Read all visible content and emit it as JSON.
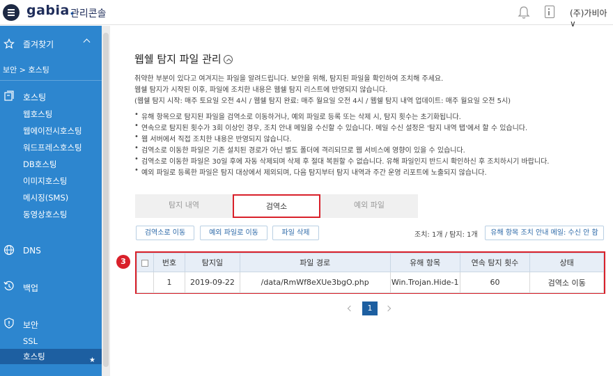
{
  "header": {
    "logo": "gabia",
    "logo_dot": ".",
    "title": "관리콘솔",
    "user": "(주)가비아 ∨"
  },
  "sidebar": {
    "favorites_label": "즐겨찾기",
    "favorite_item": "보안 > 호스팅",
    "groups": [
      {
        "title": "호스팅",
        "items": [
          "웹호스팅",
          "웹에이전시호스팅",
          "워드프레스호스팅",
          "DB호스팅",
          "이미지호스팅",
          "메시징(SMS)",
          "동영상호스팅"
        ]
      },
      {
        "title": "DNS",
        "items": []
      },
      {
        "title": "백업",
        "items": []
      },
      {
        "title": "보안",
        "items": [
          "SSL",
          "호스팅"
        ]
      }
    ],
    "active_star": "★"
  },
  "main": {
    "title": "웹쉘 탐지 파일 관리",
    "intro": [
      "취약한 부분이 있다고 여겨지는 파일을 알려드립니다. 보안을 위해, 탐지된 파일을 확인하여 조치해 주세요.",
      "웹쉘 탐지가 시작된 이후, 파일에 조치한 내용은 웹쉘 탐지 리스트에 반영되지 않습니다.",
      "(웹쉘 탐지 시작: 매주 토요일 오전 4시 / 웹쉘 탐지 완료: 매주 월요일 오전 4시 / 웹쉘 탐지 내역 업데이트: 매주 월요일 오전 5시)"
    ],
    "bullets": [
      "유해 항목으로 탐지된 파일을 검역소로 이동하거나, 예외 파일로 등록 또는 삭제 시, 탐지 횟수는 초기화됩니다.",
      "연속으로 탐지된 횟수가 3회 이상인 경우, 조치 안내 메일을 수신할 수 있습니다. 메일 수신 설정은 '탐지 내역 탭'에서 할 수 있습니다.",
      "웹 서버에서 직접 조치한 내용은 반영되지 않습니다.",
      "검역소로 이동한 파일은 기존 설치된 경로가 아닌 별도 폴더에 격리되므로 웹 서비스에 영향이 있을 수 있습니다.",
      "검역소로 이동한 파일은 30일 후에 자동 삭제되며 삭제 후 절대 복원할 수 없습니다. 유해 파일인지 반드시 확인하신 후 조치하시기 바랍니다.",
      "예외 파일로 등록한 파일은 탐지 대상에서 제외되며, 다음 탐지부터 탐지 내역과 주간 운영 리포트에 노출되지 않습니다."
    ],
    "tabs": [
      "탐지 내역",
      "검역소",
      "예외 파일"
    ],
    "buttons": {
      "move": "검역소로 이동",
      "exception": "예외 파일로 이동",
      "delete": "파일 삭제",
      "mail": "유해 항목 조치 안내 메일: 수신 안 함"
    },
    "counts": "조치: 1개 / 탐지: 1개",
    "step_badge": "3",
    "table": {
      "headers": [
        "번호",
        "탐지일",
        "파일 경로",
        "유해 항목",
        "연속 탐지 횟수",
        "상태"
      ],
      "rows": [
        [
          "1",
          "2019-09-22",
          "/data/RmWf8eXUe3bgO.php",
          "Win.Trojan.Hide-1",
          "60",
          "검역소 이동"
        ]
      ]
    },
    "pagination": {
      "current": "1"
    }
  }
}
